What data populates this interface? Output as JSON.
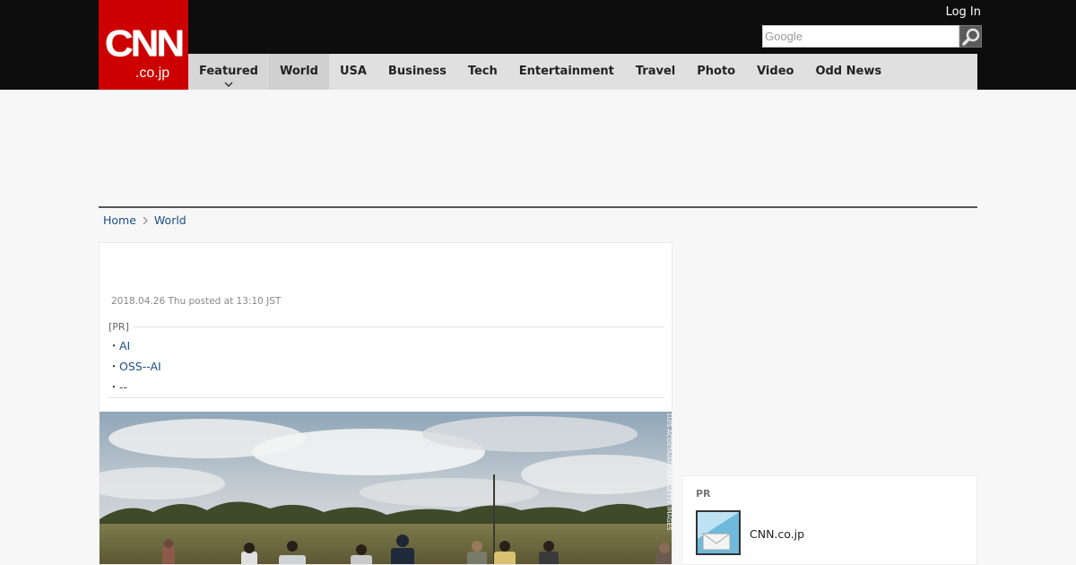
{
  "logo": {
    "main": "CNN",
    "sub": ".co.jp"
  },
  "header": {
    "login_label": "Log In",
    "search_placeholder": "Google"
  },
  "nav": {
    "items": [
      {
        "label": "Featured"
      },
      {
        "label": "World"
      },
      {
        "label": "USA"
      },
      {
        "label": "Business"
      },
      {
        "label": "Tech"
      },
      {
        "label": "Entertainment"
      },
      {
        "label": "Travel"
      },
      {
        "label": "Photo"
      },
      {
        "label": "Video"
      },
      {
        "label": "Odd News"
      }
    ]
  },
  "breadcrumb": {
    "home": "Home",
    "current": "World"
  },
  "article": {
    "posted": "2018.04.26 Thu posted at 13:10 JST",
    "pr_label": "[PR]",
    "pr_links": [
      {
        "bullet": "・",
        "label": "AI"
      },
      {
        "bullet": "・",
        "label": "OSS--AI"
      },
      {
        "bullet": "・",
        "label": "--"
      }
    ],
    "photo_credit": "LUIS ACOSTA/AFP/AFP/GETTY IMAGES"
  },
  "sidebar": {
    "pr_label": "PR",
    "link_label": "CNN.co.jp"
  },
  "colors": {
    "brand_red": "#cc0000",
    "topbar": "#0d0d0d",
    "nav_bg": "#e0e0e0",
    "link": "#1a4f86"
  },
  "icons": [
    "search-icon",
    "chevron-down-icon",
    "chevron-right-icon",
    "envelope-icon"
  ]
}
